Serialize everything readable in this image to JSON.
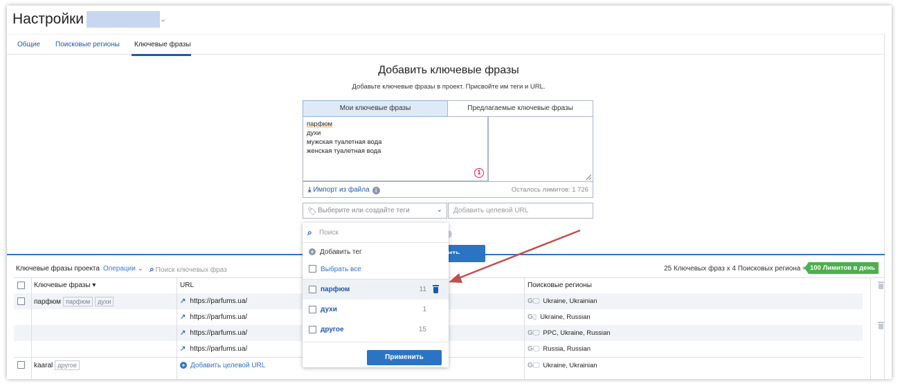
{
  "header": {
    "title": "Настройки",
    "project_chevron": "⌄"
  },
  "tabs": [
    {
      "label": "Общие"
    },
    {
      "label": "Поисковые регионы"
    },
    {
      "label": "Ключевые фразы"
    }
  ],
  "add_section": {
    "heading": "Добавить ключевые фразы",
    "subheading": "Добавьте ключевые фразы в проект. Присвойте им теги и URL.",
    "tab_mine": "Мои ключевые фразы",
    "tab_suggested": "Предлагаемые ключевые фразы",
    "textarea_lines": [
      "парфюм",
      "духи",
      "мужская туалетная вода",
      "женская туалетная вода"
    ],
    "marker": "1",
    "import_label": "Импорт из файла",
    "info_icon": "i",
    "limits_left": "Осталось лимитов: 1 726",
    "tag_placeholder": "Выберите или создайте теги",
    "tag_chevron": "⌄",
    "url_placeholder": "Добавить целевой URL",
    "add_button_partial": "вить"
  },
  "project_bar": {
    "title": "Ключевые фразы проекта",
    "operations": "Операции",
    "ops_chevron": "⌄",
    "search_placeholder": "Поиск ключевых фраз",
    "summary": "25 Ключевых фраз x 4 Поисковых региона =",
    "limit_badge": "100 Лимитов в день"
  },
  "table": {
    "col_keywords": "Ключевые фразы",
    "sort_icon": "▾",
    "col_url": "URL",
    "col_regions": "Поисковые регионы",
    "rows": [
      {
        "keyword": "парфюм",
        "tags": [
          "парфюм",
          "духи"
        ],
        "url": "https://parfums.ua/",
        "g": "G",
        "device": "🖵",
        "region": "Ukraine, Ukrainian"
      },
      {
        "url": "https://parfums.ua/",
        "g": "G",
        "device": "▯",
        "region": "Ukraine, Russian"
      },
      {
        "url": "https://parfums.ua/",
        "g": "G",
        "device": "🖵",
        "region": "PPC, Ukraine, Russian"
      },
      {
        "url": "https://parfums.ua/",
        "g": "G",
        "device": "🖵",
        "region": "Russia, Russian"
      },
      {
        "keyword": "kaaral",
        "tags": [
          "другое"
        ],
        "url": "Добавить  целевой URL",
        "g": "G",
        "device": "🖵",
        "region": "Ukraine, Ukrainian"
      }
    ],
    "link_icon": "↗",
    "plus_icon": "+"
  },
  "tag_dropdown": {
    "search_placeholder": "Поиск",
    "add_tag": "Добавить тег",
    "select_all": "Выбрать все",
    "items": [
      {
        "name": "парфюм",
        "count": "11"
      },
      {
        "name": "духи",
        "count": "1"
      },
      {
        "name": "другое",
        "count": "15"
      }
    ],
    "apply": "Применить"
  },
  "colors": {
    "accent": "#2b74c4",
    "badge": "#4caf50",
    "arrow": "#c0504d"
  }
}
